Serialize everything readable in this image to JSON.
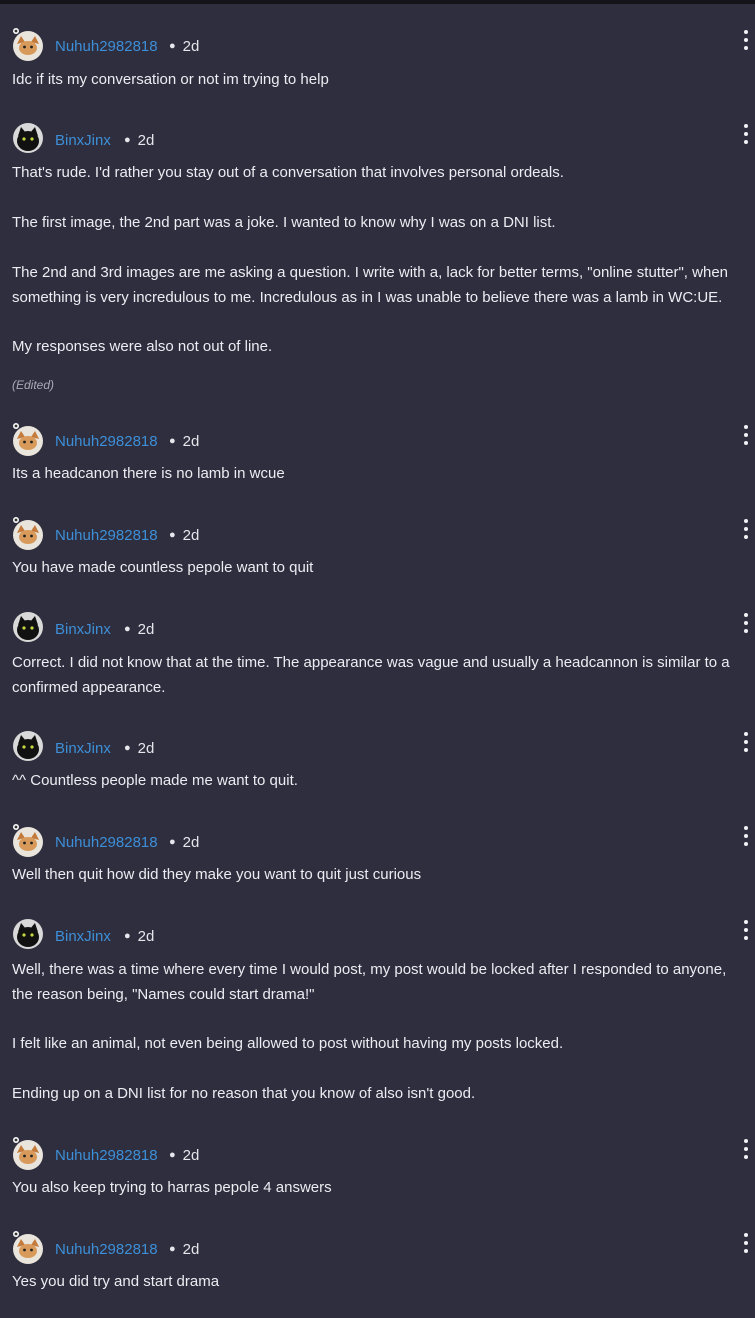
{
  "comments": [
    {
      "author": "Nuhuh2982818",
      "avatar": "nuhuh-avatar",
      "age": "2d",
      "paragraphs": [
        "Idc if its my conversation or not im trying to help"
      ]
    },
    {
      "author": "BinxJinx",
      "avatar": "binx-avatar",
      "age": "2d",
      "paragraphs": [
        "That's rude. I'd rather you stay out of a conversation that involves personal ordeals.",
        "The first image, the 2nd part was a joke. I wanted to know why I was on a DNI list.",
        "The 2nd and 3rd images are me asking a question. I write with a, lack for better terms, \"online stutter\", when something is very incredulous to me. Incredulous as in I was unable to believe there was a lamb in WC:UE.",
        "My responses were also not out of line."
      ],
      "edited": "(Edited)"
    },
    {
      "author": "Nuhuh2982818",
      "avatar": "nuhuh-avatar",
      "age": "2d",
      "paragraphs": [
        "Its a headcanon there is no lamb in wcue"
      ]
    },
    {
      "author": "Nuhuh2982818",
      "avatar": "nuhuh-avatar",
      "age": "2d",
      "paragraphs": [
        "You have made countless pepole want to quit"
      ]
    },
    {
      "author": "BinxJinx",
      "avatar": "binx-avatar",
      "age": "2d",
      "paragraphs": [
        "Correct. I did not know that at the time. The appearance was vague and usually a headcannon is similar to a confirmed appearance."
      ]
    },
    {
      "author": "BinxJinx",
      "avatar": "binx-avatar",
      "age": "2d",
      "paragraphs": [
        "^^ Countless people made me want to quit."
      ]
    },
    {
      "author": "Nuhuh2982818",
      "avatar": "nuhuh-avatar",
      "age": "2d",
      "paragraphs": [
        "Well then quit how did they make you want to quit just curious"
      ]
    },
    {
      "author": "BinxJinx",
      "avatar": "binx-avatar",
      "age": "2d",
      "paragraphs": [
        "Well, there was a time where every time I would post, my post would be locked after I responded to anyone, the reason being, \"Names could start drama!\"",
        "I felt like an animal, not even being allowed to post without having my posts locked.",
        "Ending up on a DNI list for no reason that you know of also isn't good."
      ]
    },
    {
      "author": "Nuhuh2982818",
      "avatar": "nuhuh-avatar",
      "age": "2d",
      "paragraphs": [
        "You also keep trying to harras pepole 4 answers"
      ]
    },
    {
      "author": "Nuhuh2982818",
      "avatar": "nuhuh-avatar",
      "age": "2d",
      "paragraphs": [
        "Yes you did try and start drama"
      ]
    }
  ],
  "colors": {
    "background": "#2e2e3e",
    "username": "#3d8fd8",
    "text": "#ececf2"
  },
  "icons": {
    "more": "vertical-dots-icon"
  }
}
